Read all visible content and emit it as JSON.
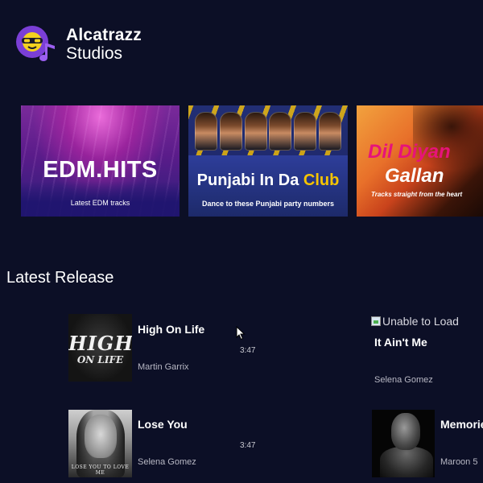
{
  "brand": {
    "name": "Alcatrazz",
    "subtitle": "Studios"
  },
  "banners": [
    {
      "title": "EDM.HITS",
      "subtitle": "Latest EDM tracks"
    },
    {
      "title_main": "Punjabi In Da ",
      "title_accent": "Club",
      "subtitle": "Dance to these Punjabi party numbers"
    },
    {
      "title_line1": "Dil Diyan",
      "title_line2": "Gallan",
      "subtitle": "Tracks straight from the heart"
    }
  ],
  "latest": {
    "heading": "Latest Release",
    "tracks": [
      {
        "title": "High On Life",
        "artist": "Martin Garrix",
        "duration": "3:47",
        "cover_text_1": "HIGH",
        "cover_text_2": "ON LIFE"
      },
      {
        "title": "It Ain't Me",
        "artist": "Selena Gomez",
        "image_alt": "Unable to Load"
      },
      {
        "title": "Lose You",
        "artist": "Selena Gomez",
        "duration": "3:47",
        "cover_caption": "LOSE YOU TO LOVE ME"
      },
      {
        "title": "Memories",
        "artist": "Maroon 5"
      }
    ]
  },
  "colors": {
    "background": "#0c0f26",
    "logo_purple": "#7b3fd6",
    "logo_yellow": "#f5d21f",
    "club_accent": "#f6c400",
    "dil_accent": "#e7137a"
  }
}
